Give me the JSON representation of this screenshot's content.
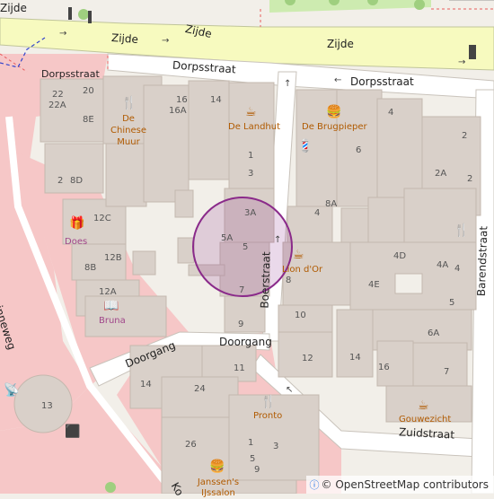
{
  "streets": {
    "zijde_1": "Zijde",
    "zijde_2": "Zijde",
    "zijde_3": "Zijde",
    "zijde_top": "Zijde",
    "dorpsstraat_1": "Dorpsstraat",
    "dorpsstraat_2": "Dorpsstraat",
    "dorpsstraat_3": "Dorpsstraat",
    "boerstraat": "Boerstraat",
    "koninginneweg": "Koninginneweg",
    "doorgang_1": "Doorgang",
    "doorgang_2": "Doorgang",
    "zuidstraat": "Zuidstraat",
    "barendstraat": "Barendstraat",
    "bottom_cut": "Ko"
  },
  "pois": {
    "chinese_muur": "De Chinese Muur",
    "landhuis": "De Landhut",
    "brugpieper": "De Brugpieper",
    "does": "Does",
    "bruna": "Bruna",
    "lion_dor": "Lion d'Or",
    "pronto": "Pronto",
    "gouwezicht": "Gouwezicht",
    "janssens": "Janssen's IJssalon"
  },
  "house_numbers": [
    "22",
    "20",
    "22A",
    "8E",
    "2",
    "8D",
    "12C",
    "12B",
    "8B",
    "12A",
    "16",
    "16A",
    "14",
    "1",
    "3",
    "3A",
    "5A",
    "5",
    "7",
    "9",
    "4",
    "8A",
    "6",
    "4",
    "2",
    "2A",
    "2",
    "4D",
    "4A",
    "4",
    "4E",
    "5",
    "8",
    "10",
    "12",
    "14",
    "16",
    "6A",
    "7",
    "11",
    "14",
    "24",
    "26",
    "13",
    "1",
    "3",
    "5",
    "9"
  ],
  "attribution": "© OpenStreetMap contributors",
  "icons": {
    "restaurant": "knife-fork-icon",
    "bar": "cup-icon",
    "fastfood": "burger-icon",
    "hairdresser": "comb-icon",
    "gift": "gift-icon",
    "books": "book-icon",
    "antenna": "antenna-icon",
    "marker_circle": "search-radius-circle"
  },
  "colors": {
    "background": "#f2efe9",
    "building": "#d9d0c9",
    "pedestrian": "#f6c7c7",
    "primary_road": "#fcd6a4",
    "secondary_road": "#f7fabf",
    "highlight": "#8a2a8a",
    "poi": "#b05a00",
    "shop": "#a0468a"
  }
}
